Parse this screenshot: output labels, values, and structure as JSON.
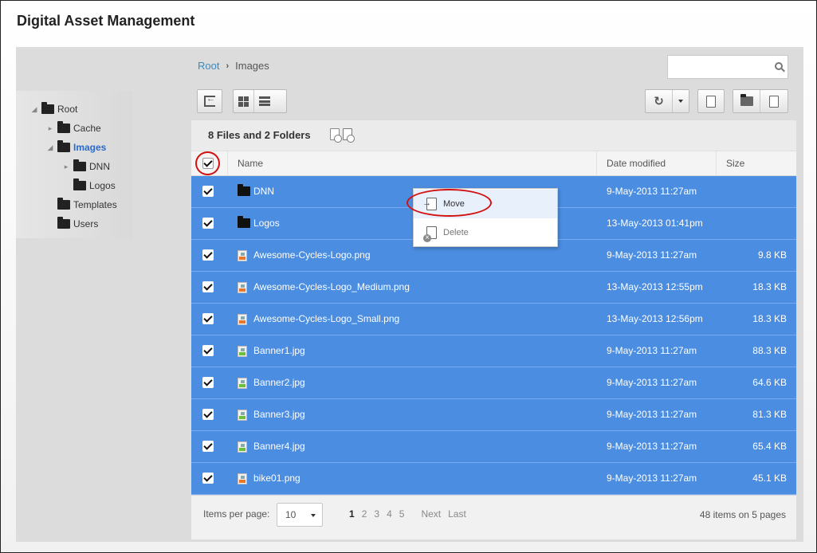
{
  "app": {
    "title": "Digital Asset Management"
  },
  "breadcrumb": {
    "root": "Root",
    "separator": "›",
    "current": "Images"
  },
  "search": {
    "value": "",
    "placeholder": ""
  },
  "tree": [
    {
      "label": "Root",
      "indent": 0,
      "expander": "collapse",
      "selected": false
    },
    {
      "label": "Cache",
      "indent": 1,
      "expander": "expand",
      "selected": false
    },
    {
      "label": "Images",
      "indent": 1,
      "expander": "collapse",
      "selected": true
    },
    {
      "label": "DNN",
      "indent": 2,
      "expander": "expand",
      "selected": false
    },
    {
      "label": "Logos",
      "indent": 2,
      "expander": "none",
      "selected": false
    },
    {
      "label": "Templates",
      "indent": 1,
      "expander": "none",
      "selected": false
    },
    {
      "label": "Users",
      "indent": 1,
      "expander": "none",
      "selected": false
    }
  ],
  "toolbar": {
    "collapse_icon": "collapse-pane-icon",
    "view_icons": [
      "grid-view-icon",
      "list-view-icon"
    ],
    "refresh_icon": "refresh-icon",
    "dropdown_icon": "chevron-down-icon",
    "search_doc_icon": "search-document-icon",
    "new_folder_icon": "new-folder-icon",
    "upload_icon": "upload-icon"
  },
  "files_header": {
    "count_text": "8 Files and 2 Folders"
  },
  "columns": {
    "name": "Name",
    "date": "Date modified",
    "size": "Size"
  },
  "rows": [
    {
      "name": "DNN",
      "type": "folder",
      "date": "9-May-2013 11:27am",
      "size": ""
    },
    {
      "name": "Logos",
      "type": "folder",
      "date": "13-May-2013 01:41pm",
      "size": ""
    },
    {
      "name": "Awesome-Cycles-Logo.png",
      "type": "png",
      "date": "9-May-2013 11:27am",
      "size": "9.8 KB"
    },
    {
      "name": "Awesome-Cycles-Logo_Medium.png",
      "type": "png",
      "date": "13-May-2013 12:55pm",
      "size": "18.3 KB"
    },
    {
      "name": "Awesome-Cycles-Logo_Small.png",
      "type": "png",
      "date": "13-May-2013 12:56pm",
      "size": "18.3 KB"
    },
    {
      "name": "Banner1.jpg",
      "type": "jpg",
      "date": "9-May-2013 11:27am",
      "size": "88.3 KB"
    },
    {
      "name": "Banner2.jpg",
      "type": "jpg",
      "date": "9-May-2013 11:27am",
      "size": "64.6 KB"
    },
    {
      "name": "Banner3.jpg",
      "type": "jpg",
      "date": "9-May-2013 11:27am",
      "size": "81.3 KB"
    },
    {
      "name": "Banner4.jpg",
      "type": "jpg",
      "date": "9-May-2013 11:27am",
      "size": "65.4 KB"
    },
    {
      "name": "bike01.png",
      "type": "png",
      "date": "9-May-2013 11:27am",
      "size": "45.1 KB"
    }
  ],
  "context_menu": {
    "move_label": "Move",
    "delete_label": "Delete"
  },
  "footer": {
    "items_per_page_label": "Items per page:",
    "items_per_page_value": "10",
    "pages": [
      "1",
      "2",
      "3",
      "4",
      "5"
    ],
    "current_page": "1",
    "next_label": "Next",
    "last_label": "Last",
    "page_info": "48 items on 5 pages"
  },
  "colors": {
    "selected_row": "#4b8de0",
    "link": "#3a8ac0",
    "highlight_ring": "#d31010"
  }
}
